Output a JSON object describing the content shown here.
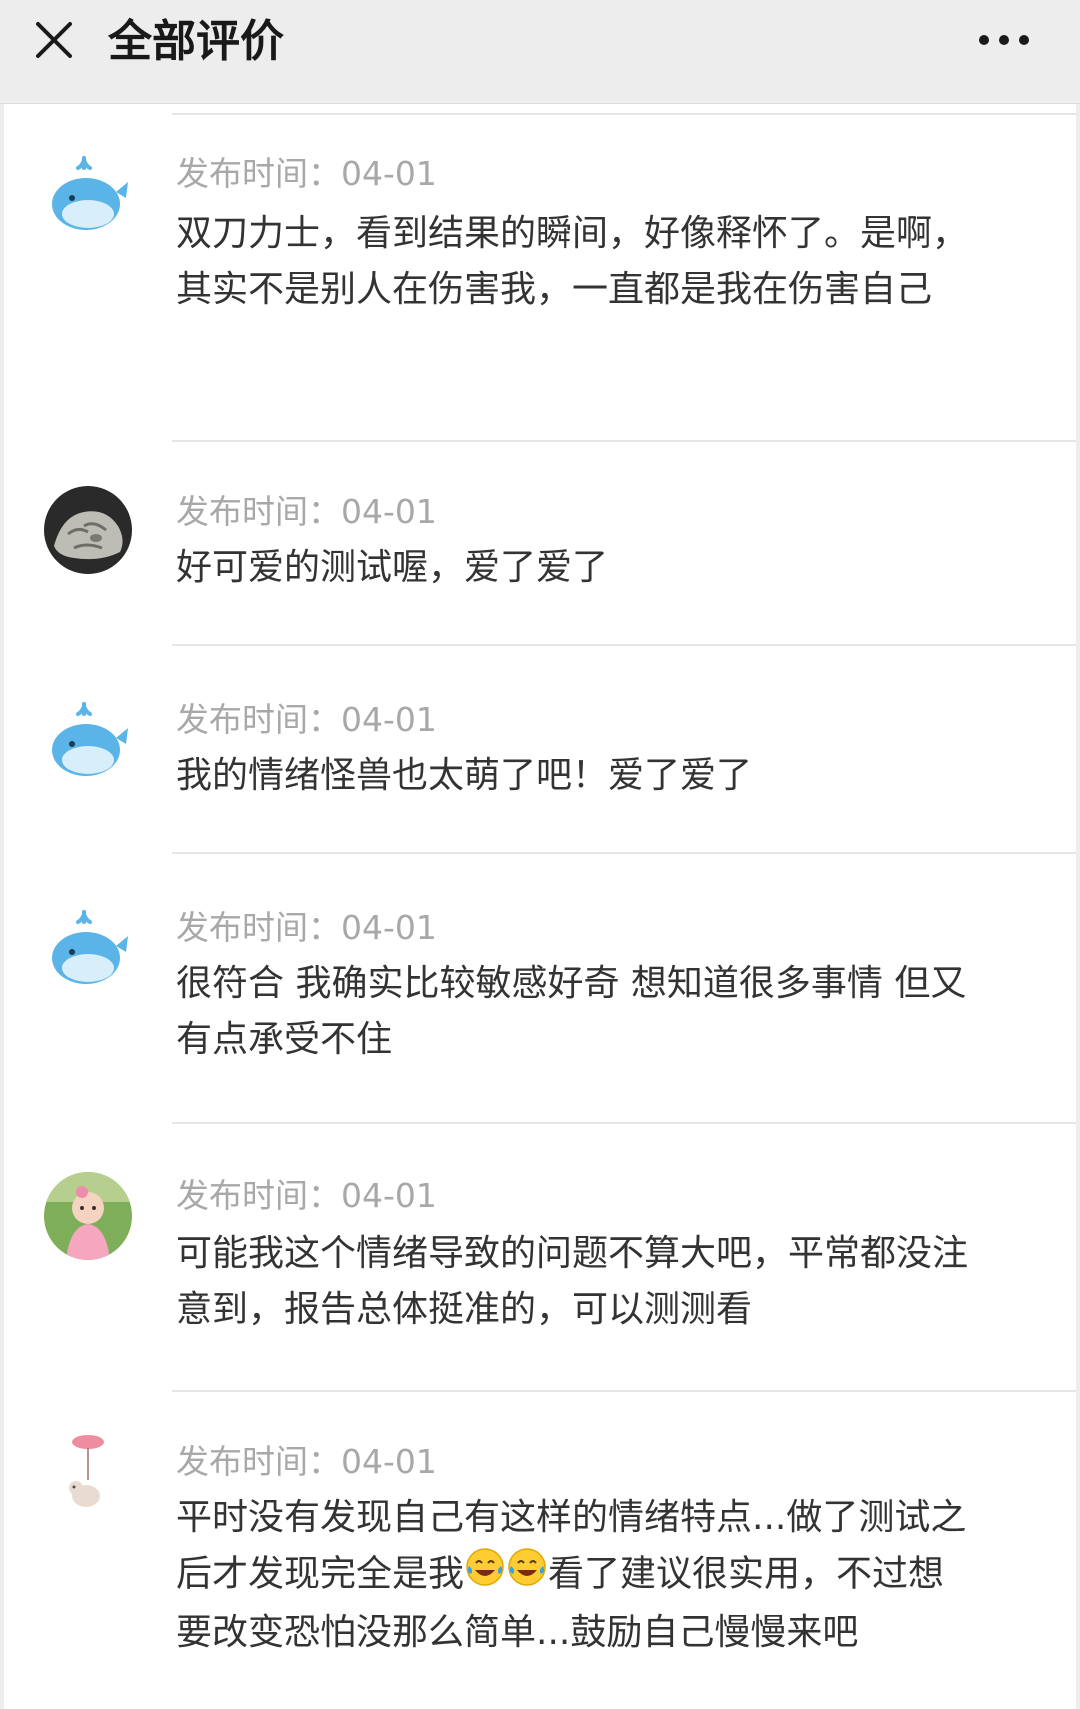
{
  "header": {
    "title": "全部评价",
    "close_icon": "close-icon",
    "more_icon": "more-horizontal-icon"
  },
  "colors": {
    "header_bg": "#ededed",
    "time_text": "#a8a8a8",
    "content_text": "#333333",
    "whale_blue": "#5ab4e8"
  },
  "comments": [
    {
      "avatar": "whale-avatar",
      "time": "发布时间：04-01",
      "content": "双刀力士，看到结果的瞬间，好像释怀了。是啊，其实不是别人在伤害我，一直都是我在伤害自己"
    },
    {
      "avatar": "rock-photo-avatar",
      "time": "发布时间：04-01",
      "content": "好可爱的测试喔，爱了爱了"
    },
    {
      "avatar": "whale-avatar",
      "time": "发布时间：04-01",
      "content": "我的情绪怪兽也太萌了吧！爱了爱了"
    },
    {
      "avatar": "whale-avatar",
      "time": "发布时间：04-01",
      "content": "很符合 我确实比较敏感好奇 想知道很多事情 但又有点承受不住"
    },
    {
      "avatar": "baby-photo-avatar",
      "time": "发布时间：04-01",
      "content": "可能我这个情绪导致的问题不算大吧，平常都没注意到，报告总体挺准的，可以测测看"
    },
    {
      "avatar": "balloon-elephant-avatar",
      "time": "发布时间：04-01",
      "content_before": "平时没有发现自己有这样的情绪特点...做了测试之后才发现完全是我",
      "emojis": [
        "tears-of-joy-emoji",
        "tears-of-joy-emoji"
      ],
      "content_after": "看了建议很实用，不过想要改变恐怕没那么简单...鼓励自己慢慢来吧"
    }
  ]
}
